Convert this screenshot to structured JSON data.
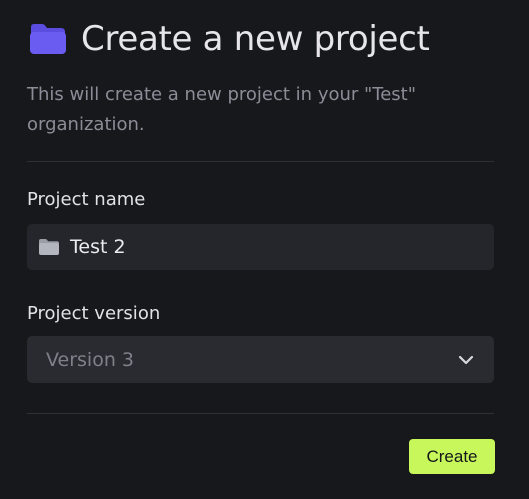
{
  "dialog": {
    "title": "Create a new project",
    "subtitle": "This will create a new project in your \"Test\" organization.",
    "title_icon": "folder-icon"
  },
  "form": {
    "project_name": {
      "label": "Project name",
      "value": "Test 2",
      "icon": "folder-icon"
    },
    "project_version": {
      "label": "Project version",
      "selected": "Version 3",
      "icon": "chevron-down-icon"
    }
  },
  "actions": {
    "create_label": "Create"
  },
  "colors": {
    "background": "#17181c",
    "accent_button": "#c7f75a",
    "folder_icon": "#6a5cf0"
  }
}
